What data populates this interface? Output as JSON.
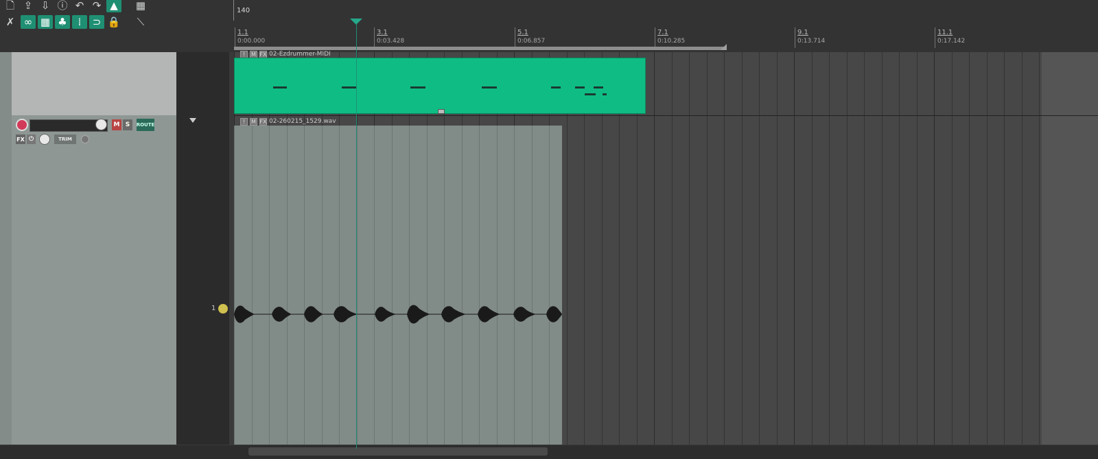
{
  "toolbar": {
    "row1": [
      "new-project-icon",
      "open-project-icon",
      "save-project-icon",
      "info-icon",
      "undo-icon",
      "redo-icon",
      "metronome-icon",
      "grid-toggle-icon"
    ],
    "row2": [
      "ripple-edit-icon",
      "link-icon",
      "snap-grid-icon",
      "group-icon",
      "dots-grid-icon",
      "loop-icon",
      "lock-icon",
      "envelope-icon"
    ]
  },
  "ruler": {
    "tempo": "140",
    "markers": [
      {
        "bar": "1.1",
        "time": "0:00.000"
      },
      {
        "bar": "3.1",
        "time": "0:03.428"
      },
      {
        "bar": "5.1",
        "time": "0:06.857"
      },
      {
        "bar": "7.1",
        "time": "0:10.285"
      },
      {
        "bar": "9.1",
        "time": "0:13.714"
      },
      {
        "bar": "11.1",
        "time": "0:17.142"
      }
    ]
  },
  "tracks": [
    {
      "item_name": "02-Ezdrummer-MIDI"
    },
    {
      "number": "1",
      "item_name": "02-260215_1529.wav",
      "fx_label": "FX",
      "route_label": "ROUTE",
      "trim_label": "TRIM",
      "mute_label": "M",
      "solo_label": "S"
    }
  ],
  "item_buttons": {
    "mute": "M",
    "fx": "FX"
  },
  "colors": {
    "accent": "#1f8f73",
    "midi_item": "#0fbd84",
    "audio_item": "#818b88",
    "playhead": "#26a88a"
  }
}
